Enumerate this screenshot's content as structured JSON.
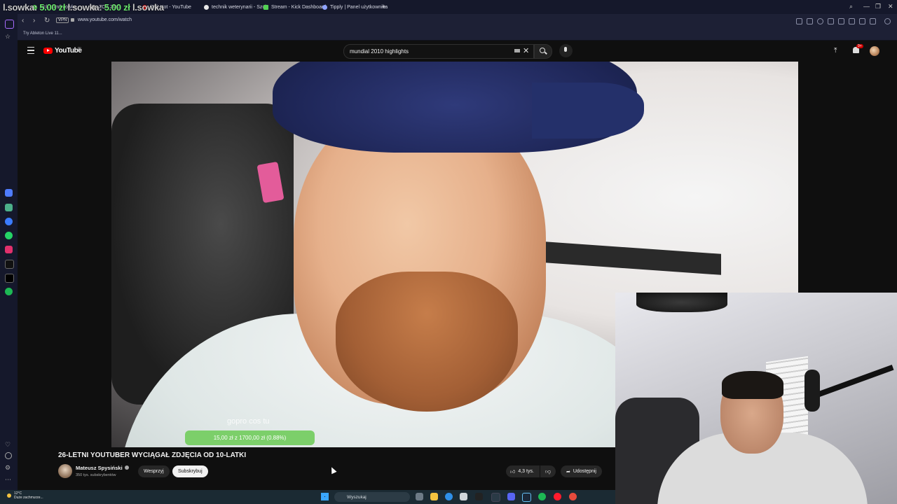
{
  "browser": {
    "tabs": [
      {
        "label": "kick.com/l.sowka"
      },
      {
        "label": "ZOA ZOG"
      },
      {
        "label": "(59) Hot - YouTube"
      },
      {
        "label": "technik weterynarii - Szuk"
      },
      {
        "label": "Stream - Kick Dashboard"
      },
      {
        "label": "Tipply | Panel użytkownika"
      }
    ],
    "stream_overlay": {
      "prefix": "l.sowka:",
      "green_part": "5.00 zł",
      "mid": "l.sowka:",
      "amount": "5.00 zł",
      "suffix": "l.sowka"
    },
    "url": "www.youtube.com/watch",
    "vpn_label": "VPN",
    "bookmarks": [
      {
        "label": "Try Ableton Live 11..."
      }
    ]
  },
  "youtube": {
    "logo_text": "YouTube",
    "country_code": "PL",
    "search": {
      "value": "mundial 2010 highlights"
    },
    "notifications_badge": "9+",
    "video": {
      "watermark": "gopro cos tu",
      "donation_bar": "15,00 zł z 1700,00 zł (0.88%)",
      "donation_progress_percent": 0.88
    },
    "title": "26-LETNI YOUTUBER WYCIĄGAŁ ZDJĘCIA OD 10-LATKI",
    "channel": {
      "name": "Mateusz Spysiński",
      "subscribers": "350 tys. subskrybentów"
    },
    "buttons": {
      "support": "Wesprzyj",
      "subscribe": "Subskrybuj",
      "likes": "4,3 tys.",
      "share": "Udostępnij"
    }
  },
  "taskbar": {
    "weather_temp": "12°C",
    "weather_desc": "Duże zachmurze...",
    "search_placeholder": "Wyszukaj"
  },
  "colors": {
    "yt_red": "#ff0000",
    "donation_green": "#7ccf6a",
    "opera_bg": "#15182b"
  }
}
